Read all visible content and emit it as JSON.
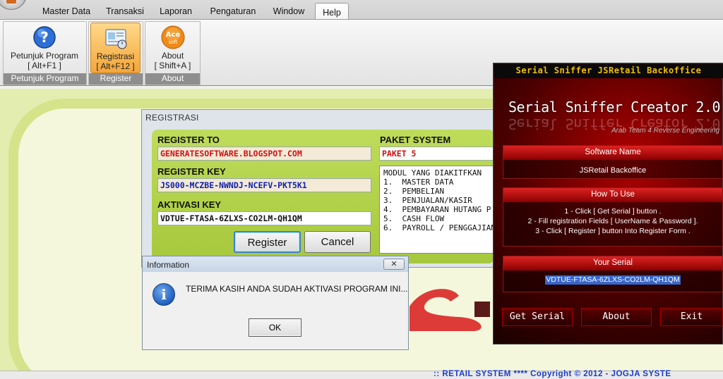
{
  "menu": {
    "items": [
      "Master Data",
      "Transaksi",
      "Laporan",
      "Pengaturan",
      "Window",
      "Help"
    ],
    "active": "Help"
  },
  "ribbon": {
    "buttons": [
      {
        "label": "Petunjuk Program",
        "shortcut": "[ Alt+F1 ]",
        "icon": "help-icon"
      },
      {
        "label": "Registrasi",
        "shortcut": "[ Alt+F12 ]",
        "icon": "registration-icon"
      },
      {
        "label": "About",
        "shortcut": "[ Shift+A ]",
        "icon": "ace-logo-icon"
      }
    ],
    "groups": [
      "Petunjuk Program",
      "Register",
      "About"
    ]
  },
  "registrasi": {
    "title": "REGISTRASI",
    "register_to_label": "REGISTER TO",
    "register_to_value": "GENERATESOFTWARE.BLOGSPOT.COM",
    "register_key_label": "REGISTER KEY",
    "register_key_value": "JS000-MCZBE-NWNDJ-NCEFV-PKT5K1",
    "aktivasi_key_label": "AKTIVASI KEY",
    "aktivasi_key_value": "VDTUE-FTASA-6ZLXS-CO2LM-QH1QM",
    "paket_label": "PAKET SYSTEM",
    "paket_value": "PAKET 5",
    "modules_header": "MODUL YANG DIAKITFKAN",
    "modules": [
      "1.  MASTER DATA",
      "2.  PEMBELIAN",
      "3.  PENJUALAN/KASIR",
      "4.  PEMBAYARAN HUTANG P",
      "5.  CASH FLOW",
      "6.  PAYROLL / PENGGAJIAN"
    ],
    "register_button": "Register",
    "cancel_button": "Cancel"
  },
  "info_dialog": {
    "title": "Information",
    "message": "TERIMA KASIH ANDA SUDAH AKTIVASI PROGRAM INI...",
    "ok_button": "OK",
    "close_glyph": "✕"
  },
  "keygen": {
    "banner": "Serial Sniffer JSRetail Backoffice",
    "title": "Serial Sniffer Creator 2.0",
    "subtitle": "Arab Team 4 Reverse Engineering",
    "software_name_label": "Software Name",
    "software_name_value": "JSRetail Backoffice",
    "how_to_label": "How To Use",
    "how_to_steps": [
      "1 - Click [ Get Serial ] button .",
      "2 - Fill registration Fields [ UserName & Password ].",
      "3 - Click [ Register ] button Into Register Form ."
    ],
    "your_serial_label": "Your Serial",
    "serial_value": "VDTUE-FTASA-6ZLXS-CO2LM-QH1QM",
    "buttons": [
      "Get Serial",
      "About",
      "Exit"
    ]
  },
  "footer": {
    "text": ":: RETAIL SYSTEM  ****  Copyright © 2012 - JOGJA SYSTE"
  }
}
